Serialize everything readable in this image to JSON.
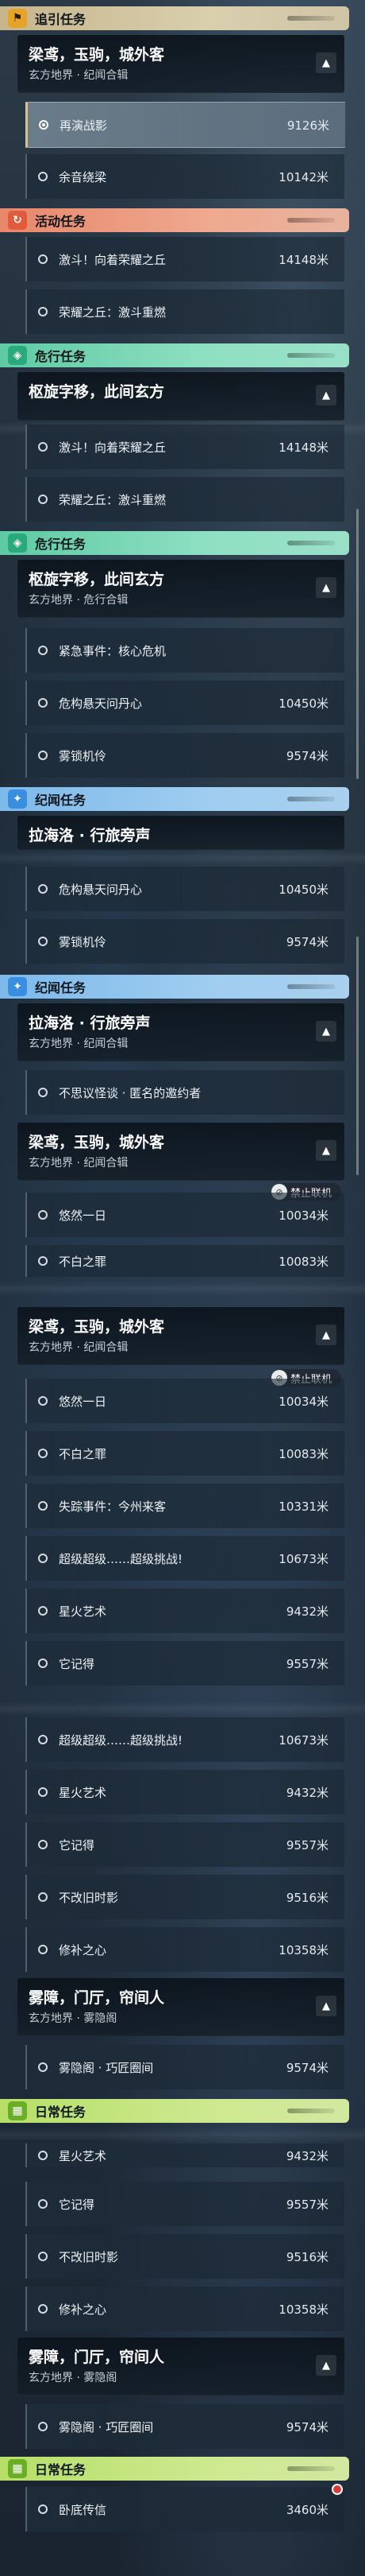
{
  "headers": {
    "guide": "追引任务",
    "event": "活动任务",
    "danger": "危行任务",
    "record": "纪闻任务",
    "daily": "日常任务"
  },
  "missions": {
    "liang": {
      "title": "梁鸢，玉驹，城外客",
      "sub": "玄方地界 · 纪闻合辑"
    },
    "xuan": {
      "title": "枢旋字移，此间玄方",
      "sub": "玄方地界 · 危行合辑"
    },
    "lahai": {
      "title": "拉海洛 · 行旅旁声",
      "sub": "玄方地界 · 纪闻合辑"
    },
    "wuzhang": {
      "title": "雾障，门厅，帘间人",
      "sub": "玄方地界 · 雾隐阁"
    }
  },
  "tasks": {
    "rehearse": {
      "name": "再演战影",
      "dist": "9126米"
    },
    "yuyin": {
      "name": "余音绕梁",
      "dist": "10142米"
    },
    "jidou1": {
      "name": "激斗！向着荣耀之丘",
      "dist": "14148米"
    },
    "jidou2": {
      "name": "荣耀之丘：激斗重燃",
      "dist": ""
    },
    "jinji": {
      "name": "紧急事件：核心危机",
      "dist": ""
    },
    "weihang": {
      "name": "危构悬天问丹心",
      "dist": "10450米"
    },
    "wusuo": {
      "name": "雾锁机伶",
      "dist": "9574米"
    },
    "bukeyi": {
      "name": "不思议怪谈 · 匿名的邀约者",
      "dist": ""
    },
    "youran": {
      "name": "悠然一日",
      "dist": "10034米"
    },
    "buzhi": {
      "name": "不白之罪",
      "dist": "10083米"
    },
    "shiyue": {
      "name": "失踪事件：今州来客",
      "dist": "10331米"
    },
    "chaoji": {
      "name": "超级超级……超级挑战!",
      "dist": "10673米"
    },
    "xinghuo": {
      "name": "星火艺术",
      "dist": "9432米"
    },
    "taji": {
      "name": "它记得",
      "dist": "9557米"
    },
    "bugai": {
      "name": "不改旧时影",
      "dist": "9516米"
    },
    "xiubu": {
      "name": "修补之心",
      "dist": "10358米"
    },
    "wuyin": {
      "name": "雾隐阁 · 巧匠圈间",
      "dist": "9574米"
    },
    "wosha": {
      "name": "卧底传信",
      "dist": "3460米"
    }
  },
  "offline_tag": "禁止联机",
  "collapse_icon": "▲",
  "colors": {
    "guide": "#c6b58d",
    "event": "#e7876b",
    "danger": "#5ecaa3",
    "record": "#7db9ea",
    "daily": "#b6df67"
  }
}
